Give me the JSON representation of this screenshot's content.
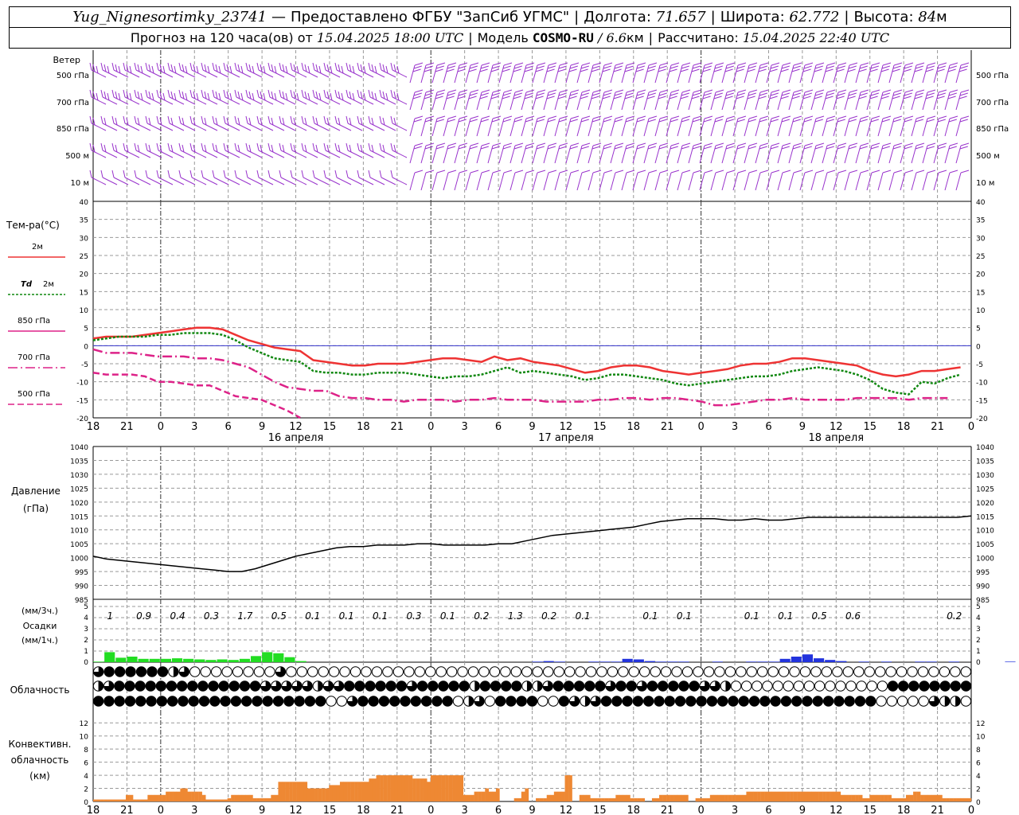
{
  "header": {
    "station": "Yug_Nignesortimky_23741",
    "dash": "—",
    "provider": "Предоставлено ФГБУ \"ЗапСиб УГМС\"",
    "lon_label": "Долгота:",
    "lon": "71.657",
    "lat_label": "Широта:",
    "lat": "62.772",
    "alt_label": "Высота:",
    "alt": "84",
    "alt_unit": "м",
    "forecast_prefix": "Прогноз на 120 часа(ов) от",
    "forecast_time": "15.04.2025 18:00 UTC",
    "model_label": "Модель",
    "model": "COSMO-RU",
    "model_res": "/ 6.6",
    "model_res_unit": "км",
    "calc_label": "Рассчитано:",
    "calc_time": "15.04.2025 22:40 UTC",
    "bar": "|"
  },
  "wind": {
    "title": "Ветер",
    "levels": [
      "500 гПа",
      "700 гПа",
      "850 гПа",
      "500 м",
      "10 м"
    ],
    "barb_color": "#9933cc"
  },
  "temperature": {
    "title": "Тем-ра(°С)",
    "legend": [
      {
        "label": "2м",
        "color": "#ee3333",
        "dash": ""
      },
      {
        "label_prefix": "Td",
        "label": "2м",
        "color": "#118811",
        "dash": "3,2"
      },
      {
        "label": "850 гПа",
        "color": "#dd2288",
        "dash": ""
      },
      {
        "label": "700 гПа",
        "color": "#dd2288",
        "dash": "12,4,2,4"
      },
      {
        "label": "500 гПа",
        "color": "#dd2288",
        "dash": "8,4"
      }
    ]
  },
  "pressure": {
    "title1": "Давление",
    "title2": "(гПа)"
  },
  "precip": {
    "title1": "(мм/3ч.)",
    "title2": "Осадки",
    "title3": "(мм/1ч.)"
  },
  "clouds": {
    "title": "Облачность"
  },
  "convective": {
    "title1": "Конвективн.",
    "title2": "облачность",
    "title3": "(км)"
  },
  "time_axis": {
    "hour_labels": [
      "18",
      "21",
      "0",
      "3",
      "6",
      "9",
      "12",
      "15",
      "18",
      "21",
      "0",
      "3",
      "6",
      "9",
      "12",
      "15",
      "18",
      "21",
      "0",
      "3",
      "6",
      "9",
      "12",
      "15",
      "18",
      "21",
      "0"
    ],
    "day_labels": [
      "16 апреля",
      "17 апреля",
      "18 апреля"
    ]
  },
  "chart_data": [
    {
      "type": "line",
      "name": "temperature",
      "x_hours": [
        0,
        1,
        2,
        3,
        4,
        5,
        6,
        7,
        8,
        9,
        10,
        11,
        12,
        13,
        14,
        15,
        16,
        17,
        18,
        19,
        20,
        21,
        22,
        23,
        24,
        25,
        26,
        27,
        28,
        29,
        30,
        31,
        32,
        33,
        34,
        35,
        36,
        37,
        38,
        39,
        40,
        41,
        42,
        43,
        44,
        45,
        46,
        47,
        48,
        49,
        50,
        51,
        52,
        53,
        54,
        55,
        56,
        57,
        58,
        59,
        60,
        61,
        62,
        63,
        64,
        65,
        66,
        67,
        68,
        69,
        70,
        71,
        72,
        73,
        74,
        75,
        76,
        77,
        78
      ],
      "ylim": [
        -20,
        40
      ],
      "yticks": [
        40,
        35,
        30,
        25,
        20,
        15,
        10,
        5,
        0,
        -5,
        -10,
        -15,
        -20
      ],
      "series": [
        {
          "name": "2м",
          "color": "#ee3333",
          "width": 2.5,
          "dash": "",
          "values": [
            2,
            2.5,
            2.5,
            2.5,
            3,
            3.5,
            4,
            4.5,
            5,
            5,
            4.5,
            3,
            1.5,
            0.5,
            -0.5,
            -1,
            -1.5,
            -4,
            -4.5,
            -5,
            -5.5,
            -5.5,
            -5,
            -5,
            -5,
            -4.5,
            -4,
            -3.5,
            -3.5,
            -4,
            -4.5,
            -3,
            -4,
            -3.5,
            -4.5,
            -5,
            -5.5,
            -6.5,
            -7.5,
            -7,
            -6,
            -5.5,
            -5.5,
            -6,
            -7,
            -7.5,
            -8,
            -7.5,
            -7,
            -6.5,
            -5.5,
            -5,
            -5,
            -4.5,
            -3.5,
            -3.5,
            -4,
            -4.5,
            -5,
            -5.5,
            -7,
            -8,
            -8.5,
            -8,
            -7,
            -7,
            -6.5,
            -6
          ]
        },
        {
          "name": "Td 2м",
          "color": "#118811",
          "width": 2.5,
          "dash": "3,2",
          "values": [
            1.5,
            2,
            2.5,
            2.5,
            2.5,
            3,
            3,
            3.5,
            3.5,
            3.5,
            3,
            1.5,
            -0.5,
            -2,
            -3.5,
            -4,
            -4.5,
            -7,
            -7.5,
            -7.5,
            -8,
            -8,
            -7.5,
            -7.5,
            -7.5,
            -8,
            -8.5,
            -9,
            -8.5,
            -8.5,
            -8,
            -7,
            -6,
            -7.5,
            -7,
            -7.5,
            -8,
            -8.5,
            -9.5,
            -9,
            -8,
            -8,
            -8.5,
            -9,
            -9.5,
            -10.5,
            -11,
            -10.5,
            -10,
            -9.5,
            -9,
            -8.5,
            -8.5,
            -8,
            -7,
            -6.5,
            -6,
            -6.5,
            -7,
            -8,
            -9.5,
            -12,
            -13,
            -13.5,
            -10,
            -10.5,
            -9,
            -8
          ]
        },
        {
          "name": "850 гПа",
          "color": "#dd2288",
          "width": 2.5,
          "dash": "12,4,2,4",
          "values": [
            -1,
            -2,
            -2,
            -2,
            -2.5,
            -3,
            -3,
            -3,
            -3.5,
            -3.5,
            -4,
            -5,
            -6,
            -8,
            -10,
            -11.5,
            -12,
            -12.5,
            -12.5,
            -14,
            -14.5,
            -14.5,
            -15,
            -15,
            -15.5,
            -15,
            -15,
            -15,
            -15.5,
            -15,
            -15,
            -14.5,
            -15,
            -15,
            -15,
            -15.5,
            -15.5,
            -15.5,
            -15.5,
            -15,
            -15,
            -14.5,
            -14.5,
            -15,
            -14.5,
            -14.5,
            -15,
            -15.5,
            -16.5,
            -16.5,
            -16,
            -15.5,
            -15,
            -15,
            -14.5,
            -15,
            -15,
            -15,
            -15,
            -14.5,
            -14.5,
            -14.5,
            -14.5,
            -15,
            -14.5,
            -14.5,
            -14.5
          ]
        },
        {
          "name": "700 гПа",
          "color": "#dd2288",
          "width": 2.5,
          "dash": "8,4",
          "values": [
            -7.5,
            -8,
            -8,
            -8,
            -8.5,
            -10,
            -10,
            -10.5,
            -11,
            -11,
            -12.5,
            -14,
            -14.5,
            -15,
            -16.5,
            -18,
            -20
          ]
        }
      ]
    },
    {
      "type": "line",
      "name": "pressure",
      "ylim": [
        985,
        1040
      ],
      "yticks": [
        1040,
        1035,
        1030,
        1025,
        1020,
        1015,
        1010,
        1005,
        1000,
        995,
        990,
        985
      ],
      "series": [
        {
          "name": "pressure",
          "color": "#000000",
          "values": [
            1000.5,
            999.5,
            999,
            998.5,
            998,
            997.5,
            997,
            996.5,
            996,
            995.5,
            995,
            995,
            996,
            997.5,
            999,
            1000.5,
            1001.5,
            1002.5,
            1003.5,
            1004,
            1004,
            1004.5,
            1004.5,
            1004.5,
            1005,
            1005,
            1004.5,
            1004.5,
            1004.5,
            1004.5,
            1005,
            1005,
            1006,
            1007,
            1008,
            1008.5,
            1009,
            1009.5,
            1010,
            1010.5,
            1011,
            1012,
            1013,
            1013.5,
            1014,
            1014,
            1014,
            1013.5,
            1013.5,
            1014,
            1013.5,
            1013.5,
            1014,
            1014.5,
            1014.5,
            1014.5,
            1014.5,
            1014.5,
            1014.5,
            1014.5,
            1014.5,
            1014.5,
            1014.5,
            1014.5,
            1014.5,
            1015
          ]
        }
      ]
    },
    {
      "type": "bar",
      "name": "precipitation",
      "ylim": [
        0,
        5
      ],
      "yticks": [
        5,
        4,
        3,
        2,
        1,
        0
      ],
      "labels_3h": [
        "1",
        "0.9",
        "0.4",
        "0.3",
        "1.7",
        "0.5",
        "0.1",
        "0.1",
        "0.1",
        "0.3",
        "0.1",
        "0.2",
        "1.3",
        "0.2",
        "0.1",
        "",
        "0.1",
        "0.1",
        "",
        "0.1",
        "0.1",
        "0.5",
        "0.6",
        "",
        "",
        "0.2"
      ],
      "bars_1h_green": [
        0.05,
        0.9,
        0.4,
        0.5,
        0.3,
        0.3,
        0.3,
        0.35,
        0.3,
        0.25,
        0.2,
        0.25,
        0.2,
        0.3,
        0.55,
        0.9,
        0.8,
        0.45,
        0.1
      ],
      "bars_1h_blue": [
        0,
        0,
        0,
        0,
        0,
        0,
        0,
        0,
        0,
        0,
        0,
        0,
        0,
        0,
        0,
        0,
        0,
        0,
        0,
        0,
        0.05,
        0.1,
        0.05,
        0,
        0,
        0.05,
        0.05,
        0.05,
        0.3,
        0.25,
        0.1,
        0.05,
        0.05,
        0.05,
        0,
        0,
        0.05,
        0,
        0,
        0.05,
        0.05,
        0.05,
        0.3,
        0.5,
        0.7,
        0.35,
        0.2,
        0.1,
        0,
        0.05,
        0,
        0.05,
        0,
        0,
        0.05,
        0.05,
        0,
        0.05,
        0,
        0,
        0,
        0,
        0.05,
        0,
        0,
        0,
        0.05,
        0.05,
        0,
        0.05,
        0.1,
        0.2,
        0.45,
        0.6,
        0.25,
        0.05,
        0,
        0,
        0,
        0.05,
        0.15,
        0.25
      ]
    },
    {
      "type": "table",
      "name": "cloud_cover",
      "rows": [
        {
          "row": "upper",
          "values": [
            3,
            4,
            4,
            4,
            4,
            4,
            4,
            2,
            3,
            0,
            0,
            0,
            0,
            0,
            0,
            0,
            0,
            3,
            0,
            0,
            0,
            0,
            0,
            0,
            0,
            0,
            0,
            0,
            0,
            0,
            0,
            0,
            0,
            0,
            0,
            0,
            0,
            0,
            0,
            0,
            0,
            0,
            0,
            0,
            0,
            0,
            0,
            0,
            0,
            0,
            0,
            0,
            0,
            0,
            0,
            0,
            0,
            0,
            0,
            0,
            0,
            0,
            0,
            0,
            0,
            0,
            0,
            0,
            0,
            0,
            0,
            0,
            0,
            0,
            0,
            0,
            0,
            0,
            0,
            0,
            0,
            0
          ]
        },
        {
          "row": "middle",
          "values": [
            2,
            3,
            4,
            4,
            4,
            4,
            4,
            4,
            4,
            4,
            4,
            4,
            4,
            4,
            4,
            4,
            3,
            3,
            3,
            3,
            3,
            2,
            3,
            3,
            4,
            4,
            4,
            4,
            4,
            4,
            3,
            4,
            4,
            4,
            4,
            4,
            2,
            4,
            4,
            4,
            4,
            2,
            2,
            3,
            4,
            4,
            4,
            4,
            4,
            3,
            4,
            4,
            3,
            4,
            4,
            4,
            4,
            4,
            3,
            3,
            2,
            0,
            0,
            0,
            0,
            0,
            0,
            0,
            0,
            0,
            0,
            0,
            0,
            0,
            0,
            0,
            4,
            4,
            4,
            4,
            4,
            4,
            4,
            4
          ]
        },
        {
          "row": "lower",
          "values": [
            4,
            4,
            4,
            4,
            4,
            4,
            4,
            4,
            4,
            4,
            4,
            4,
            4,
            4,
            4,
            4,
            4,
            4,
            4,
            4,
            4,
            4,
            0,
            0,
            3,
            4,
            4,
            4,
            4,
            4,
            4,
            4,
            4,
            4,
            0,
            2,
            3,
            0,
            4,
            4,
            4,
            4,
            0,
            0,
            4,
            3,
            2,
            3,
            4,
            4,
            4,
            4,
            4,
            4,
            4,
            4,
            4,
            4,
            4,
            4,
            4,
            4,
            4,
            4,
            4,
            4,
            4,
            4,
            4,
            4,
            4,
            4,
            4,
            4,
            0,
            0,
            0,
            0,
            0,
            3,
            2,
            2,
            0
          ]
        }
      ]
    },
    {
      "type": "bar",
      "name": "convective_cloud",
      "ylim": [
        0,
        13
      ],
      "yticks": [
        12,
        10,
        8,
        6,
        4,
        2,
        0
      ],
      "values": [
        0.3,
        0.3,
        0.3,
        0.3,
        0.3,
        0.3,
        0.3,
        0.3,
        0.3,
        1,
        1,
        0.3,
        0.3,
        0.3,
        0.3,
        1,
        1,
        1,
        1,
        1,
        1.5,
        1.5,
        1.5,
        1.5,
        2,
        2,
        1.5,
        1.5,
        1.5,
        1.5,
        1,
        0.3,
        0.3,
        0.3,
        0.3,
        0.3,
        0.3,
        0.5,
        1,
        1,
        1,
        1,
        1,
        1,
        0.5,
        0.5,
        0.5,
        0.5,
        0.5,
        1,
        1,
        3,
        3,
        3,
        3,
        3,
        3,
        3,
        3,
        2,
        2,
        2,
        2,
        2,
        2,
        2.5,
        2.5,
        2.5,
        3,
        3,
        3,
        3,
        3,
        3,
        3,
        3,
        3.5,
        3.5,
        4,
        4,
        4,
        4,
        4,
        4,
        4,
        4,
        4,
        4,
        3.5,
        3.5,
        3.5,
        3.5,
        3,
        4,
        4,
        4,
        4,
        4,
        4,
        4,
        4,
        4,
        1,
        1,
        1,
        1.5,
        1.5,
        1.5,
        2,
        1.5,
        1.5,
        2,
        0,
        0,
        0,
        0,
        0.5,
        0.5,
        1.5,
        2,
        0,
        0,
        0.5,
        0.5,
        0.5,
        1,
        1,
        1.5,
        1.5,
        1.5,
        4,
        4,
        0,
        0,
        1,
        1,
        1,
        0.5,
        0.5,
        0.5,
        0.5,
        0.5,
        0.5,
        0.5,
        1,
        1,
        1,
        1,
        0.5,
        0.5,
        0.5,
        0.5,
        0,
        0,
        0.5,
        0.5,
        1,
        1,
        1,
        1,
        1,
        1,
        1,
        1,
        0,
        0,
        0.5,
        0.5,
        0.5,
        0.5,
        1,
        1,
        1,
        1,
        1,
        1,
        1,
        1,
        1,
        1,
        1.5,
        1.5,
        1.5,
        1.5,
        1.5,
        1.5,
        1.5,
        1.5,
        1.5,
        1.5,
        1.5,
        1.5,
        1.5,
        1.5,
        1.5,
        1.5,
        1.5,
        1.5,
        1.5,
        1.5,
        1.5,
        1.5,
        1.5,
        1.5,
        1.5,
        1.5,
        1,
        1,
        1,
        1,
        1,
        1,
        0.5,
        0.5,
        1,
        1,
        1,
        1,
        1,
        1,
        0.5,
        0.5,
        0.5,
        0.5,
        1,
        1,
        1.5,
        1.5,
        1,
        1,
        1,
        1,
        1,
        1,
        0.5,
        0.5,
        0.5,
        0.5,
        0.5,
        0.5,
        0.5,
        0.5
      ]
    }
  ]
}
